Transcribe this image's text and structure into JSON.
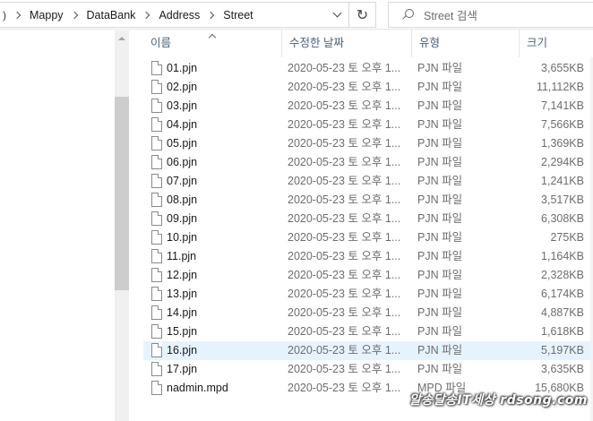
{
  "address_bar": {
    "lead": ")",
    "crumbs": [
      "Mappy",
      "DataBank",
      "Address",
      "Street"
    ]
  },
  "search": {
    "placeholder": "Street 검색"
  },
  "columns": {
    "name": "이름",
    "date": "수정한 날짜",
    "type": "유형",
    "size": "크기"
  },
  "files": [
    {
      "name": "01.pjn",
      "date": "2020-05-23 토 오후 1...",
      "type": "PJN 파일",
      "size": "3,655KB"
    },
    {
      "name": "02.pjn",
      "date": "2020-05-23 토 오후 1...",
      "type": "PJN 파일",
      "size": "11,112KB"
    },
    {
      "name": "03.pjn",
      "date": "2020-05-23 토 오후 1...",
      "type": "PJN 파일",
      "size": "7,141KB"
    },
    {
      "name": "04.pjn",
      "date": "2020-05-23 토 오후 1...",
      "type": "PJN 파일",
      "size": "7,566KB"
    },
    {
      "name": "05.pjn",
      "date": "2020-05-23 토 오후 1...",
      "type": "PJN 파일",
      "size": "1,369KB"
    },
    {
      "name": "06.pjn",
      "date": "2020-05-23 토 오후 1...",
      "type": "PJN 파일",
      "size": "2,294KB"
    },
    {
      "name": "07.pjn",
      "date": "2020-05-23 토 오후 1...",
      "type": "PJN 파일",
      "size": "1,241KB"
    },
    {
      "name": "08.pjn",
      "date": "2020-05-23 토 오후 1...",
      "type": "PJN 파일",
      "size": "3,517KB"
    },
    {
      "name": "09.pjn",
      "date": "2020-05-23 토 오후 1...",
      "type": "PJN 파일",
      "size": "6,308KB"
    },
    {
      "name": "10.pjn",
      "date": "2020-05-23 토 오후 1...",
      "type": "PJN 파일",
      "size": "275KB"
    },
    {
      "name": "11.pjn",
      "date": "2020-05-23 토 오후 1...",
      "type": "PJN 파일",
      "size": "1,164KB"
    },
    {
      "name": "12.pjn",
      "date": "2020-05-23 토 오후 1...",
      "type": "PJN 파일",
      "size": "2,328KB"
    },
    {
      "name": "13.pjn",
      "date": "2020-05-23 토 오후 1...",
      "type": "PJN 파일",
      "size": "6,174KB"
    },
    {
      "name": "14.pjn",
      "date": "2020-05-23 토 오후 1...",
      "type": "PJN 파일",
      "size": "4,887KB"
    },
    {
      "name": "15.pjn",
      "date": "2020-05-23 토 오후 1...",
      "type": "PJN 파일",
      "size": "1,618KB"
    },
    {
      "name": "16.pjn",
      "date": "2020-05-23 토 오후 1...",
      "type": "PJN 파일",
      "size": "5,197KB",
      "selected": true
    },
    {
      "name": "17.pjn",
      "date": "2020-05-23 토 오후 1...",
      "type": "PJN 파일",
      "size": "3,635KB"
    },
    {
      "name": "nadmin.mpd",
      "date": "2020-05-23 토 오후 1...",
      "type": "MPD 파일",
      "size": "15,680KB"
    }
  ],
  "watermark": "알송달송IT세상 rdsong.com",
  "colors": {
    "selected_row": "#e5f3ff",
    "header_text": "#4c607a",
    "muted_text": "#6d6d6d"
  },
  "icons": [
    "chevron-right-icon",
    "chevron-down-icon",
    "refresh-icon",
    "search-icon",
    "file-icon",
    "sort-up-icon"
  ]
}
